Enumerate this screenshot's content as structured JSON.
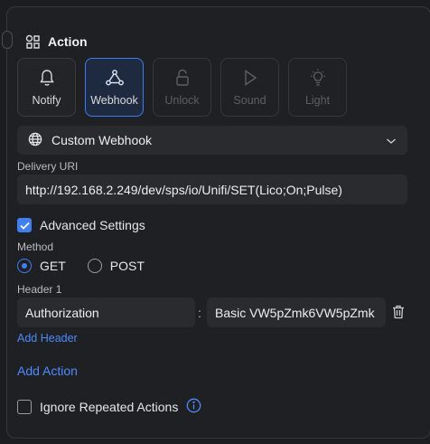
{
  "section": {
    "title": "Action"
  },
  "action_types": [
    {
      "label": "Notify",
      "icon": "bell-icon",
      "state": "normal"
    },
    {
      "label": "Webhook",
      "icon": "webhook-icon",
      "state": "active"
    },
    {
      "label": "Unlock",
      "icon": "unlock-icon",
      "state": "disabled"
    },
    {
      "label": "Sound",
      "icon": "play-icon",
      "state": "disabled"
    },
    {
      "label": "Light",
      "icon": "lightbulb-icon",
      "state": "disabled"
    }
  ],
  "webhook_type": {
    "value": "Custom Webhook",
    "icon": "globe-icon"
  },
  "delivery_url": {
    "label": "Delivery URI",
    "value": "http://192.168.2.249/dev/sps/io/Unifi/SET(Lico;On;Pulse)"
  },
  "advanced_settings": {
    "label": "Advanced Settings",
    "checked": true
  },
  "method": {
    "label": "Method",
    "options": [
      {
        "label": "GET",
        "selected": true
      },
      {
        "label": "POST",
        "selected": false
      }
    ]
  },
  "header": {
    "label": "Header 1",
    "key": "Authorization",
    "separator": ":",
    "value": "Basic VW5pZmk6VW5pZmk",
    "add_label": "Add Header"
  },
  "add_action_label": "Add Action",
  "ignore_repeated": {
    "label": "Ignore Repeated Actions",
    "checked": false
  },
  "colors": {
    "accent": "#3f7ff2",
    "link": "#4c8cff",
    "background": "#1f2023",
    "field": "#2a2b2f"
  }
}
